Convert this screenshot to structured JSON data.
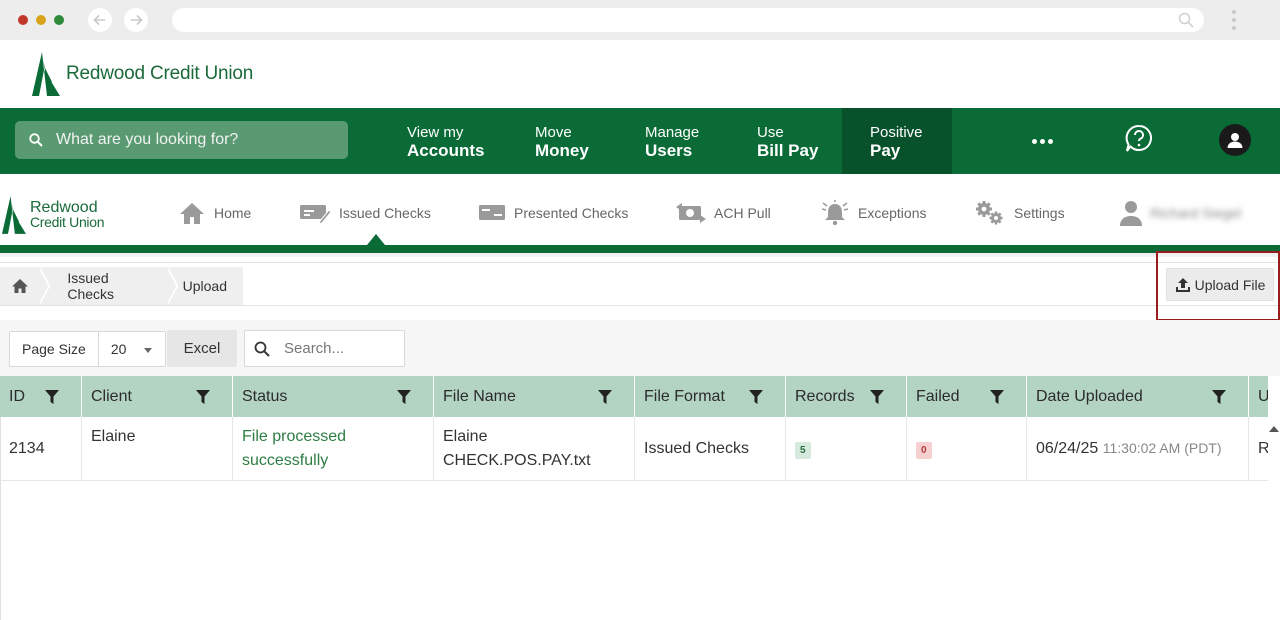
{
  "browser": {
    "url": ""
  },
  "brand": {
    "name": "Redwood Credit Union",
    "name_line1": "Redwood",
    "name_line2": "Credit Union",
    "color": "#0a6b37"
  },
  "topnav": {
    "search_placeholder": "What are you looking for?",
    "items": [
      {
        "line1": "View my",
        "line2": "Accounts"
      },
      {
        "line1": "Move",
        "line2": "Money"
      },
      {
        "line1": "Manage",
        "line2": "Users"
      },
      {
        "line1": "Use",
        "line2": "Bill Pay"
      },
      {
        "line1": "Positive",
        "line2": "Pay",
        "active": true
      }
    ],
    "more_icon": "more-dots-icon",
    "help_icon": "help-chat-icon",
    "user_icon": "user-avatar-icon"
  },
  "subnav": {
    "items": [
      {
        "label": "Home",
        "icon": "home-icon"
      },
      {
        "label": "Issued Checks",
        "icon": "issued-checks-icon",
        "active": true
      },
      {
        "label": "Presented Checks",
        "icon": "presented-checks-icon"
      },
      {
        "label": "ACH Pull",
        "icon": "ach-transfer-icon"
      },
      {
        "label": "Exceptions",
        "icon": "bell-icon"
      },
      {
        "label": "Settings",
        "icon": "gears-icon"
      }
    ],
    "user_name": "Richard Siegel"
  },
  "breadcrumb": {
    "items": [
      "Issued Checks",
      "Upload"
    ]
  },
  "actions": {
    "upload_label": "Upload File"
  },
  "toolbar": {
    "page_size_label": "Page Size",
    "page_size_value": "20",
    "excel_label": "Excel",
    "search_placeholder": "Search..."
  },
  "grid": {
    "columns": [
      "ID",
      "Client",
      "Status",
      "File Name",
      "File Format",
      "Records",
      "Failed",
      "Date Uploaded",
      "U"
    ],
    "rows": [
      {
        "id": "2134",
        "client": "Elaine",
        "status_line1": "File processed",
        "status_line2": "successfully",
        "file_name_line1": "Elaine",
        "file_name_line2": "CHECK.POS.PAY.txt",
        "file_format": "Issued Checks",
        "records": "5",
        "failed": "0",
        "date": "06/24/25",
        "time": "11:30:02 AM (PDT)",
        "uploaded_by": "R"
      }
    ]
  }
}
